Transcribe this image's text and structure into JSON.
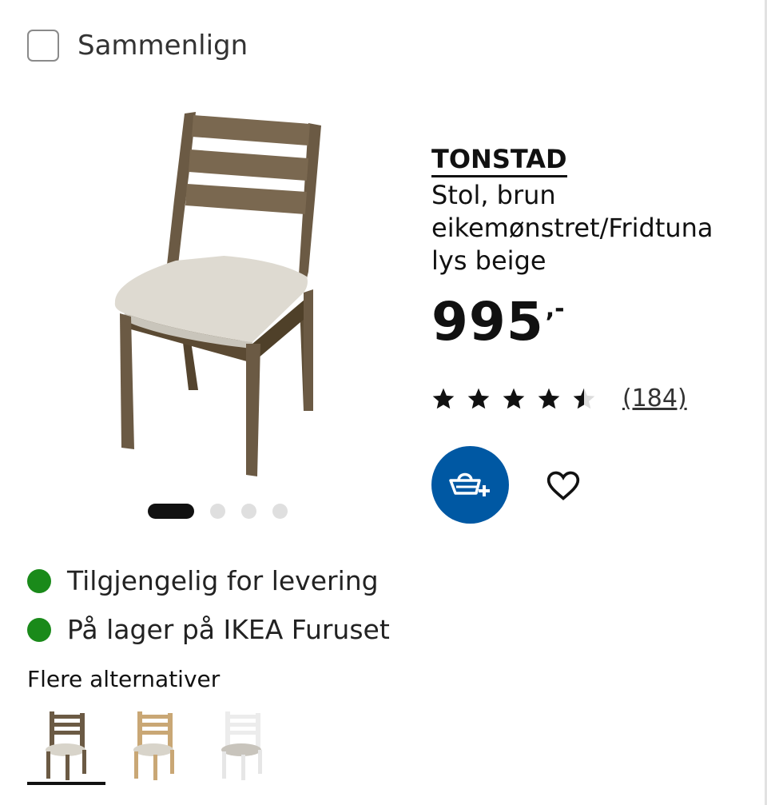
{
  "compare": {
    "label": "Sammenlign"
  },
  "product": {
    "name": "TONSTAD",
    "description": "Stol, brun eikemønstret/Fridtuna lys beige",
    "price": "995",
    "price_suffix": ",-",
    "rating": 4.5,
    "rating_max": 5,
    "review_count": "(184)"
  },
  "carousel": {
    "total": 4,
    "active": 1
  },
  "actions": {
    "cart_icon": "add-to-cart-icon",
    "favorite_icon": "heart-icon",
    "cart_color": "#0058a3"
  },
  "availability": [
    {
      "text": "Tilgjengelig for levering",
      "status_color": "#1a8a1a"
    },
    {
      "text": "På lager på IKEA Furuset",
      "status_color": "#1a8a1a"
    }
  ],
  "alternatives": {
    "title": "Flere alternativer",
    "items": [
      {
        "frame_color": "#6b5a44",
        "selected": true
      },
      {
        "frame_color": "#c9a775",
        "selected": false
      },
      {
        "frame_color": "#ececec",
        "selected": false
      }
    ]
  }
}
